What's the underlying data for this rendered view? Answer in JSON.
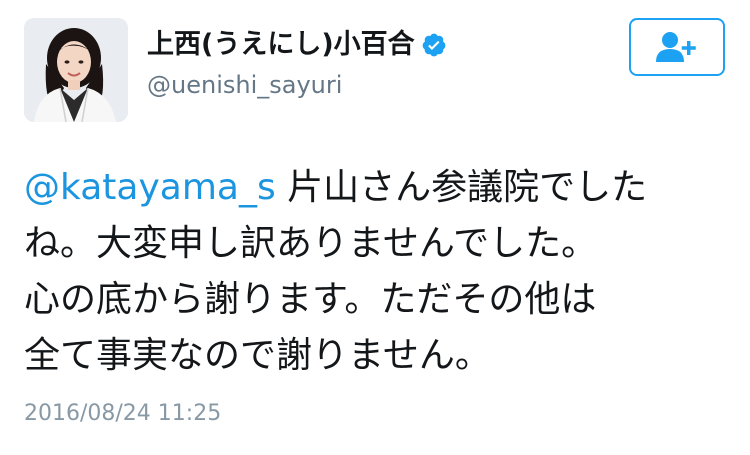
{
  "user": {
    "display_name": "上西(うえにし)小百合",
    "handle": "@uenishi_sayuri",
    "verified": true,
    "avatar_icon": "profile-photo-woman"
  },
  "follow_button": {
    "icon": "add-user-icon"
  },
  "tweet": {
    "mention": "@katayama_s",
    "line1_rest": " 片山さん参議院でした",
    "line2": "ね。大変申し訳ありませんでした。",
    "line3": "心の底から謝ります。ただその他は",
    "line4": "全て事実なので謝りません。",
    "timestamp": "2016/08/24 11:25"
  },
  "colors": {
    "accent": "#1da1f2",
    "mention": "#1b95e0",
    "handle": "#657786",
    "timestamp": "#8899a6"
  }
}
